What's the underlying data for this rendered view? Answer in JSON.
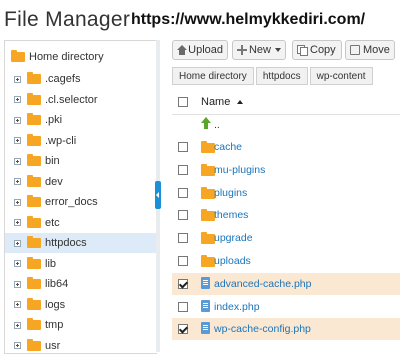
{
  "app_title": "File Manager",
  "watermark": "https://www.helmykkediri.com/",
  "toolbar": {
    "upload": "Upload",
    "new": "New",
    "copy": "Copy",
    "move": "Move"
  },
  "breadcrumb": [
    "Home directory",
    "httpdocs",
    "wp-content"
  ],
  "tree": {
    "home": "Home directory",
    "items": [
      ".cagefs",
      ".cl.selector",
      ".pki",
      ".wp-cli",
      "bin",
      "dev",
      "error_docs",
      "etc",
      "httpdocs",
      "lib",
      "lib64",
      "logs",
      "tmp",
      "usr"
    ],
    "selected": "httpdocs"
  },
  "list": {
    "column_name": "Name",
    "parent": "..",
    "rows": [
      {
        "name": "cache",
        "type": "folder",
        "checked": false
      },
      {
        "name": "mu-plugins",
        "type": "folder",
        "checked": false
      },
      {
        "name": "plugins",
        "type": "folder",
        "checked": false
      },
      {
        "name": "themes",
        "type": "folder",
        "checked": false
      },
      {
        "name": "upgrade",
        "type": "folder",
        "checked": false
      },
      {
        "name": "uploads",
        "type": "folder",
        "checked": false
      },
      {
        "name": "advanced-cache.php",
        "type": "file",
        "checked": true
      },
      {
        "name": "index.php",
        "type": "file",
        "checked": false
      },
      {
        "name": "wp-cache-config.php",
        "type": "file",
        "checked": true
      }
    ]
  },
  "colors": {
    "accent": "#1d8fd8",
    "folder": "#f6a623",
    "selected_row": "#fbe8d3",
    "tree_selected": "#dcebf7"
  }
}
